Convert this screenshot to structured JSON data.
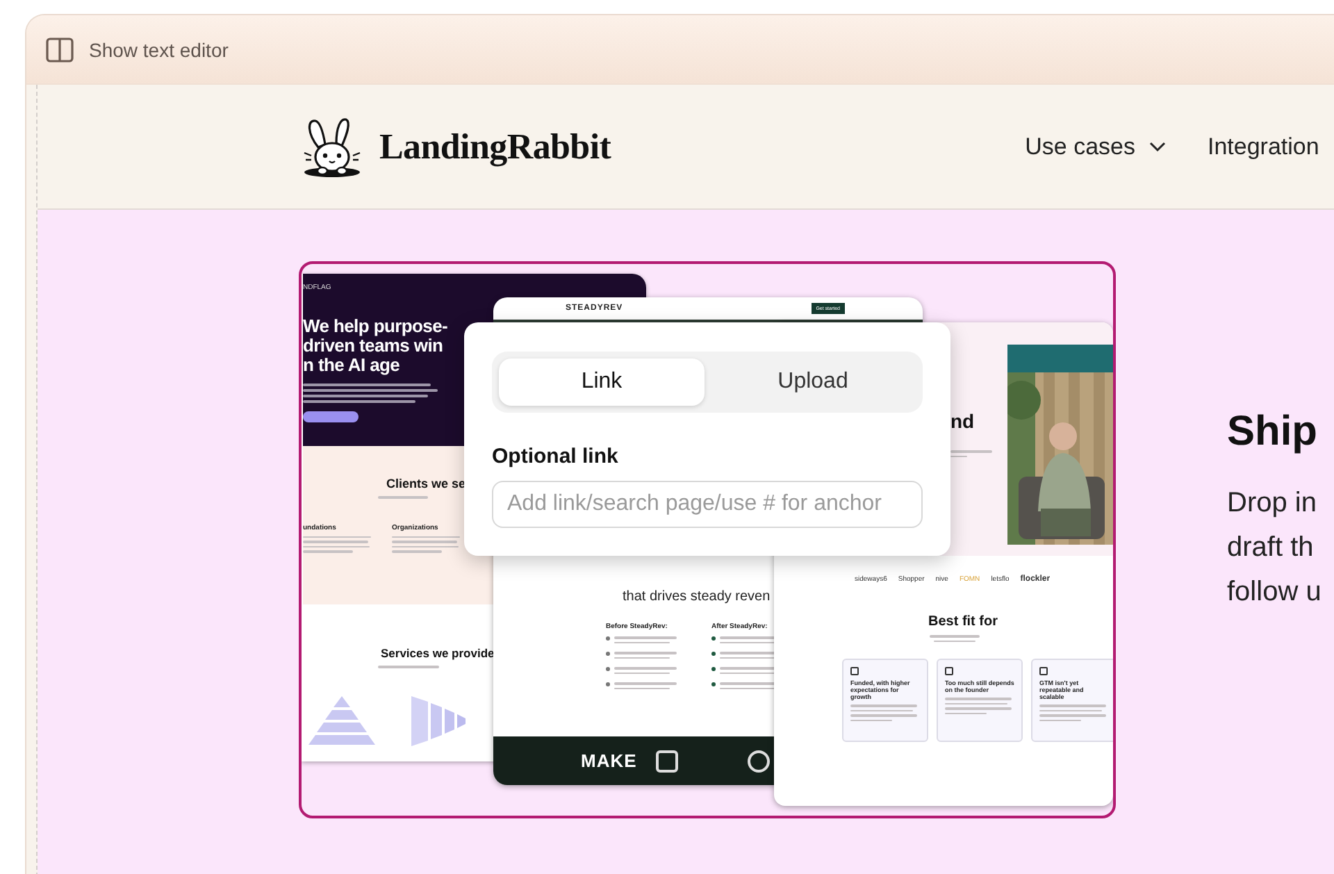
{
  "toolbar": {
    "toggle_label": "Show text editor"
  },
  "site_header": {
    "brand": "LandingRabbit",
    "nav": [
      {
        "label": "Use cases",
        "has_menu": true
      },
      {
        "label": "Integration",
        "has_menu": false
      }
    ]
  },
  "mockups": {
    "agency": {
      "brand": "NDFLAG",
      "headline": [
        "We help purpose-",
        "driven teams win",
        "n the AI age"
      ],
      "clients_heading": "Clients we se",
      "columns": [
        "undations",
        "Organizations"
      ],
      "services_heading": "Services we provide"
    },
    "steadyrev": {
      "brand": "STEADYREV",
      "cta": "Get started",
      "subheading": "that drives steady reven",
      "before_label": "Before SteadyRev:",
      "after_label": "After SteadyRev:",
      "footer_logo": "MAKE"
    },
    "saas": {
      "heading_tail": "nd",
      "logos": [
        "sideways6",
        "Shopper",
        "nive",
        "FOMN",
        "letsflo",
        "flockler"
      ],
      "fit_heading": "Best fit for",
      "fit_cards": [
        "Funded, with higher expectations for growth",
        "Too much still depends on the founder",
        "GTM isn't yet repeatable and scalable"
      ]
    }
  },
  "link_popover": {
    "tabs": [
      {
        "label": "Link",
        "selected": true
      },
      {
        "label": "Upload",
        "selected": false
      }
    ],
    "field_label": "Optional link",
    "field": {
      "placeholder": "Add link/search page/use # for anchor"
    }
  },
  "hero_text": {
    "heading": "Ship",
    "body_lines": [
      "Drop in",
      "draft th",
      "follow u"
    ]
  }
}
